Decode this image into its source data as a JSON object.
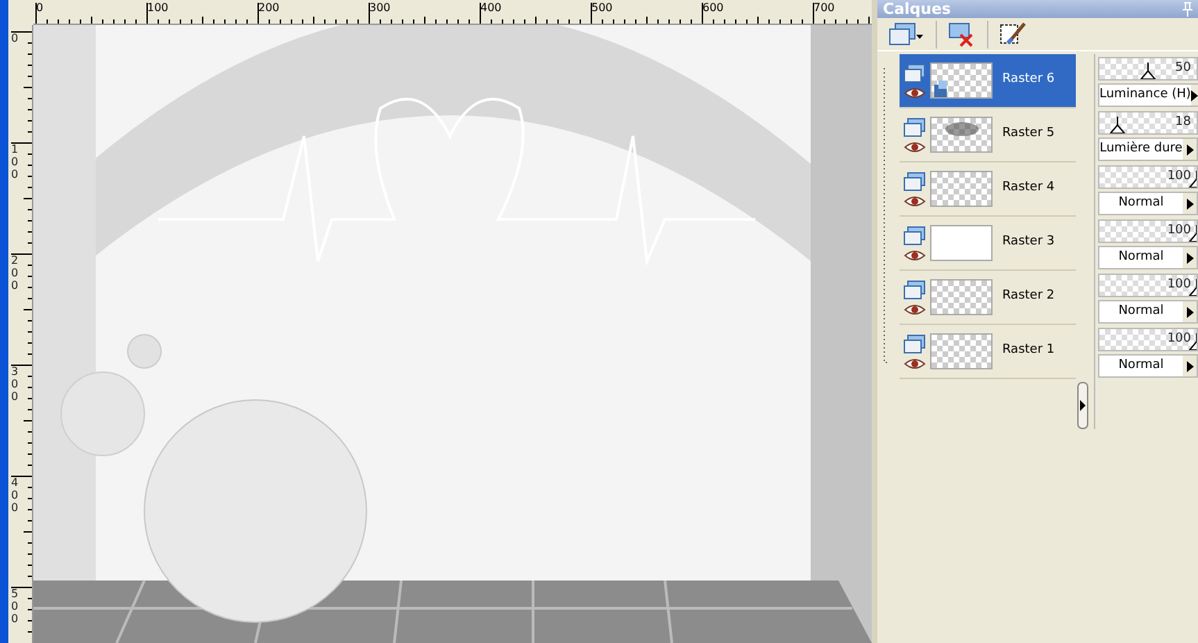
{
  "rulers": {
    "horizontal": [
      "0",
      "100",
      "200",
      "300",
      "400",
      "500",
      "600",
      "700"
    ],
    "vertical": [
      "0",
      "100",
      "200",
      "300",
      "400",
      "500"
    ]
  },
  "palette": {
    "title": "Calques",
    "layers": [
      {
        "name": "Raster 6",
        "selected": true,
        "visible": true,
        "kind": "mask",
        "opacity": "50",
        "level": 0.5,
        "blend_mode": "Luminance (H)"
      },
      {
        "name": "Raster 5",
        "selected": false,
        "visible": true,
        "kind": "smudge",
        "opacity": "18",
        "level": 0.18,
        "blend_mode": "Lumière dure"
      },
      {
        "name": "Raster 4",
        "selected": false,
        "visible": true,
        "kind": "transparent",
        "opacity": "100",
        "level": 1,
        "blend_mode": "Normal"
      },
      {
        "name": "Raster 3",
        "selected": false,
        "visible": true,
        "kind": "white",
        "opacity": "100",
        "level": 1,
        "blend_mode": "Normal"
      },
      {
        "name": "Raster 2",
        "selected": false,
        "visible": true,
        "kind": "transparent",
        "opacity": "100",
        "level": 1,
        "blend_mode": "Normal"
      },
      {
        "name": "Raster 1",
        "selected": false,
        "visible": true,
        "kind": "transparent",
        "opacity": "100",
        "level": 1,
        "blend_mode": "Normal"
      }
    ]
  }
}
